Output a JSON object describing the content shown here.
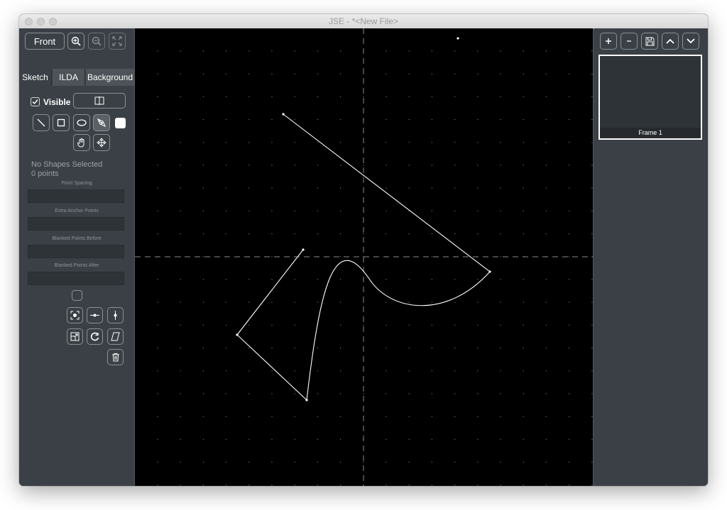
{
  "window": {
    "title": "JSE - *<New File>"
  },
  "toolbar": {
    "view_button": "Front",
    "zoom_in": "zoom-in-icon",
    "zoom_out": "zoom-out-icon",
    "fit": "fit-view-icon"
  },
  "tabs": [
    {
      "label": "Sketch",
      "active": true
    },
    {
      "label": "ILDA",
      "active": false
    },
    {
      "label": "Background",
      "active": false
    }
  ],
  "sketch": {
    "visible_label": "Visible",
    "visible_checked": true,
    "selection_status": "No Shapes Selected",
    "points_count": "0 points",
    "fields": [
      {
        "label": "Point Spacing",
        "value": ""
      },
      {
        "label": "Extra Anchor Points",
        "value": ""
      },
      {
        "label": "Blanked Points Before",
        "value": ""
      },
      {
        "label": "Blanked Points After",
        "value": ""
      }
    ],
    "color_swatch": "#ffffff"
  },
  "frames": {
    "toolbar": [
      "add-frame-icon",
      "remove-frame-icon",
      "save-frame-icon",
      "move-up-icon",
      "move-down-icon"
    ],
    "items": [
      {
        "label": "Frame 1",
        "selected": true
      }
    ]
  },
  "colors": {
    "panel": "#3a4046",
    "canvas": "#000000",
    "stroke": "#ffffff"
  }
}
